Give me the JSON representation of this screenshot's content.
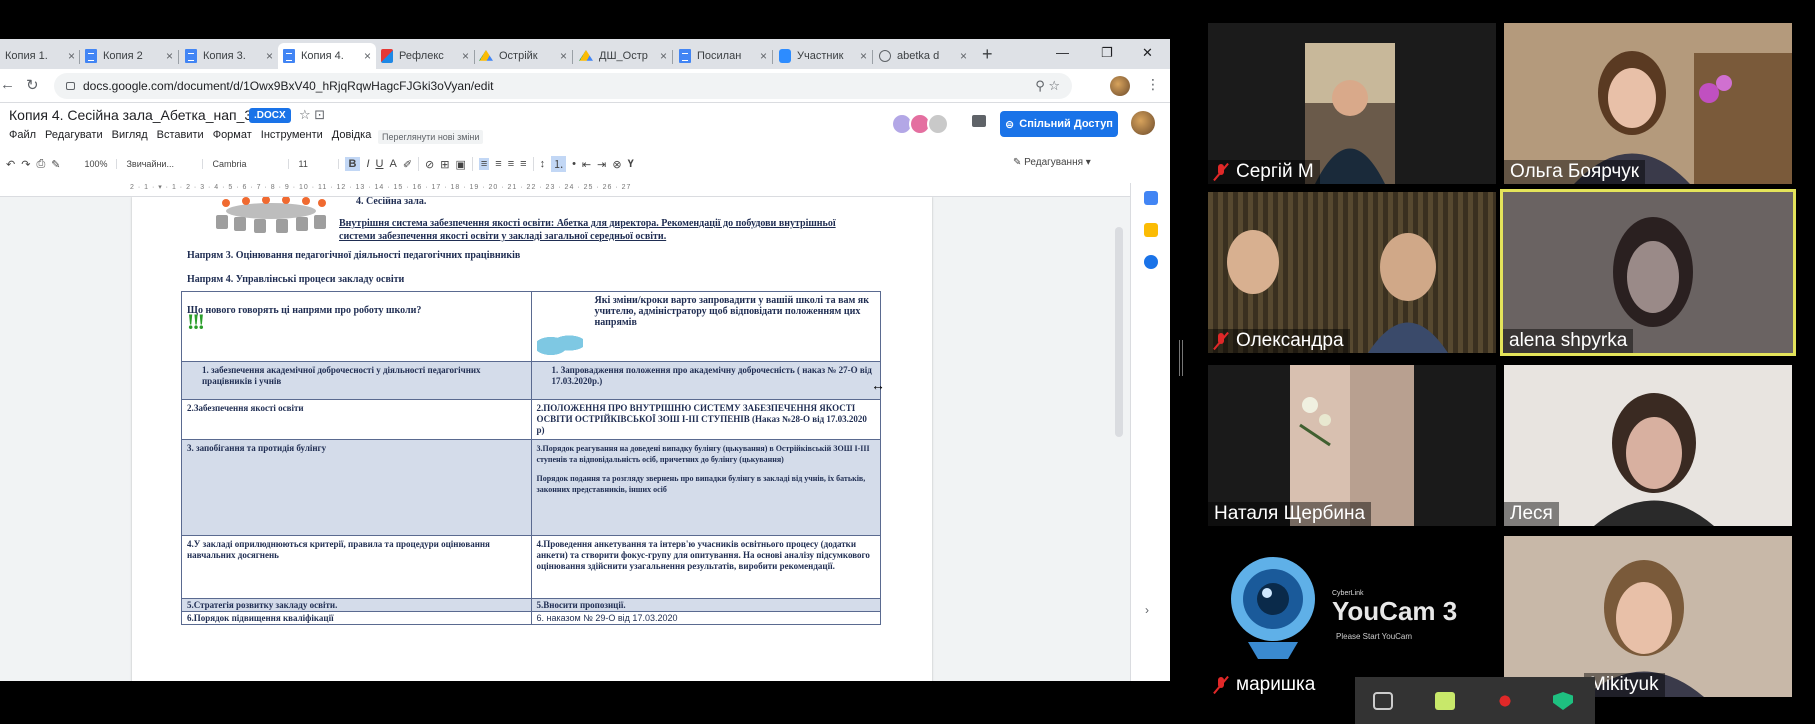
{
  "browser": {
    "tabs": [
      {
        "label": "Копия 1.",
        "icon": "docs-icon"
      },
      {
        "label": "Копия 2",
        "icon": "docs-icon"
      },
      {
        "label": "Копия 3.",
        "icon": "docs-icon"
      },
      {
        "label": "Копия 4.",
        "icon": "docs-icon",
        "active": true
      },
      {
        "label": "Рефлекс",
        "icon": "slides-icon"
      },
      {
        "label": "Острійк",
        "icon": "drive-icon"
      },
      {
        "label": "ДШ_Остр",
        "icon": "drive-icon"
      },
      {
        "label": "Посилан",
        "icon": "docs-icon"
      },
      {
        "label": "Участник",
        "icon": "zoom-icon"
      },
      {
        "label": "abetka d",
        "icon": "globe-icon"
      }
    ],
    "close_glyph": "×",
    "new_tab": "+",
    "window": {
      "minimize": "—",
      "restore": "❐",
      "close": "✕"
    },
    "nav": {
      "back": "←",
      "reload": "↻"
    },
    "url": "docs.google.com/document/d/1Owx9BxV40_hRjqRqwHagcFJGki3oVyan/edit",
    "omni_icons": "⚲  ☆",
    "kebab": "⋮"
  },
  "docs": {
    "title": "Копия 4. Сесійна зала_Абетка_нап_3_4",
    "badge": ".DOCX",
    "title_icons": "☆  ⊡",
    "menu": [
      "Файл",
      "Редагувати",
      "Вигляд",
      "Вставити",
      "Формат",
      "Інструменти",
      "Довідка"
    ],
    "new_changes": "Переглянути нові зміни",
    "share_label": "Спільний Доступ",
    "editing_label": "Редагування",
    "toolbar": {
      "undo": "↶",
      "redo": "↷",
      "print": "⎙",
      "paint": "✎",
      "zoom": "100%",
      "style": "Звичайни...",
      "font": "Cambria",
      "size": "11",
      "bold": "B",
      "italic": "I",
      "underline": "U",
      "color": "A",
      "highlight": "✐",
      "link": "⊘",
      "comment": "⊞",
      "image": "▣",
      "align_left": "≡",
      "align_center": "≡",
      "align_right": "≡",
      "align_justify": "≡",
      "line_spacing": "↕",
      "numbered": "⒈",
      "bulleted": "•",
      "indent_less": "⇤",
      "indent_more": "⇥",
      "clear": "⊗",
      "input": "Ү"
    },
    "ruler": "2 · 1 · ▾ · 1 · 2 · 3 · 4 · 5 · 6 · 7 · 8 · 9 · 10 · 11 · 12 · 13 · 14 · 15 · 16 · 17 · 18 · 19 · 20 · 21 · 22 · 23 · 24 · 25 · 26 · 27"
  },
  "document": {
    "item4": "4.   Сесійна зала.",
    "link_text": "Внутрішня система забезпечення якості освіти: Абетка для директора. Рекомендації до побудови внутрішньої системи забезпечення якості освіти у закладі загальної середньої освіти.",
    "heading3": "Напрям 3. Оцінювання педагогічної діяльності педагогічних працівників",
    "heading4": "Напрям 4. Управлінські процеси закладу освіти",
    "table": {
      "header_left": "Що нового говорять ці напрями про роботу школи?",
      "exclaim": "!!!",
      "header_right": "Які зміни/кроки варто запровадити у вашій школі та вам як учителю, адміністратору щоб відповідати положенням цих напрямів",
      "rows": [
        {
          "left": "1.    забезпечення академічної доброчесності у діяльності педагогічних працівників і учнів",
          "right": "1.    Запровадження положення про академічну доброчесність ( наказ № 27-О від 17.03.2020р.)",
          "blue": true
        },
        {
          "left": "2.Забезпечення якості освіти",
          "right": "2.ПОЛОЖЕННЯ ПРО ВНУТРІШНЮ СИСТЕМУ ЗАБЕЗПЕЧЕННЯ ЯКОСТІ ОСВІТИ ОСТРІЙКІВСЬКОЇ ЗОШ І-ІІІ СТУПЕНІВ (Наказ №28-О від 17.03.2020 р)",
          "blue": false
        },
        {
          "left": "3. запобігання та протидія булінгу",
          "right": "3.Порядок реагування на доведені випадку булінгу (цькування) в Острійківській ЗОШ І-ІІІ ступенів та відповідальність осіб, причетних до булінгу (цькування)",
          "right2": "Порядок подання та розгляду звернень про випадки булінгу в закладі від учнів, їх батьків, законних представників, інших осіб",
          "blue": true
        },
        {
          "left": "4.У закладі оприлюднюються критерії, правила та процедури оцінювання навчальних досягнень",
          "right": "4.Проведення анкетування та інтерв'ю учасників освітнього процесу (додатки анкети) та створити фокус-групу для опитування. На основі аналізу підсумкового оцінювання здійснити узагальнення результатів, виробити рекомендації.",
          "blue": false
        },
        {
          "left": "5.Стратегія розвитку закладу освіти.",
          "right": "5.Вносити пропозиції.",
          "blue": true
        },
        {
          "left": "6.Порядок підвищення кваліфікації",
          "right": "6. наказом № 29-О від 17.03.2020",
          "blue": false
        }
      ]
    },
    "resize_cursor": "↔"
  },
  "zoom": {
    "participants": [
      {
        "name": "Сергій М",
        "muted": true
      },
      {
        "name": "Ольга Боярчук",
        "muted": false
      },
      {
        "name": "Олександра",
        "muted": true
      },
      {
        "name": "alena shpyrka",
        "muted": false,
        "active": true
      },
      {
        "name": "Наталя Щербина",
        "muted": false
      },
      {
        "name": "Леся",
        "muted": false
      },
      {
        "name": "маришка",
        "muted": true
      },
      {
        "name": "Mikityuk",
        "muted": true
      }
    ],
    "youcam": {
      "brand": "CyberLink",
      "title": "YouCam 3",
      "subtitle": "Please Start YouCam"
    }
  },
  "colors": {
    "accent": "#1a73e8",
    "active_speaker": "#e4e45a",
    "mute": "#e02828"
  }
}
